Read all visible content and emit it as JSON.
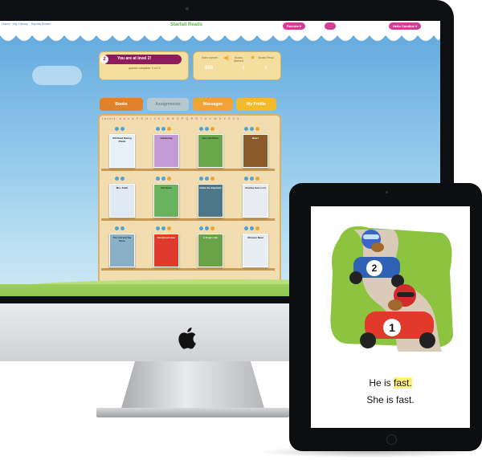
{
  "app": {
    "breadcrumb": "Home · My Library · Sophia Brown",
    "logo": "Starfall Reads",
    "parents_button": "Parents ▾",
    "hello_button": "Hello Caroline ▾"
  },
  "level": {
    "badge": "2",
    "text": "You are at level 2!",
    "progress": "quizzes complete: 0 of 12"
  },
  "stats": {
    "stars_label": "Stars earned",
    "stars_value": "500",
    "books_label": "Books listened",
    "books_value": "1",
    "read_label": "Books Read",
    "read_value": "1"
  },
  "tabs": [
    "Books",
    "Assignments",
    "Messages",
    "My Profile"
  ],
  "alphabet": "Levels:  a  b  c  d  F  G  H  I  J  K  L  M  N  O  P  Q  R  S  T  U  V  W  X  Y  Z  2  3",
  "books": [
    {
      "title": "Off-Road Racing Rivals",
      "color": "#e8f0f8"
    },
    {
      "title": "Gardening",
      "color": "#c49bd6"
    },
    {
      "title": "Sun and Moon",
      "color": "#68a84a"
    },
    {
      "title": "Bears",
      "color": "#8a5a2a"
    },
    {
      "title": "Mrs. Kitch",
      "color": "#dfe9f3"
    },
    {
      "title": "Pet Grow",
      "color": "#69b25e"
    },
    {
      "title": "Eddie the Elephant",
      "color": "#4d7688"
    },
    {
      "title": "Charley Gets Lost",
      "color": "#e8ecf0"
    },
    {
      "title": "The Ant and the Dove",
      "color": "#8ab0c8"
    },
    {
      "title": "Storybook Hour",
      "color": "#e03a2f"
    },
    {
      "title": "A Frog's Life",
      "color": "#6aa24a"
    },
    {
      "title": "Monster Meal",
      "color": "#e8edf2"
    }
  ],
  "reader": {
    "line1_prefix": "He is ",
    "line1_highlight": "fast.",
    "line2": "She is fast.",
    "car1_number": "2",
    "car2_number": "1"
  },
  "colors": {
    "accent_pink": "#d53e95",
    "shelf": "#f1ddb0",
    "sky": "#5fa7dc"
  }
}
